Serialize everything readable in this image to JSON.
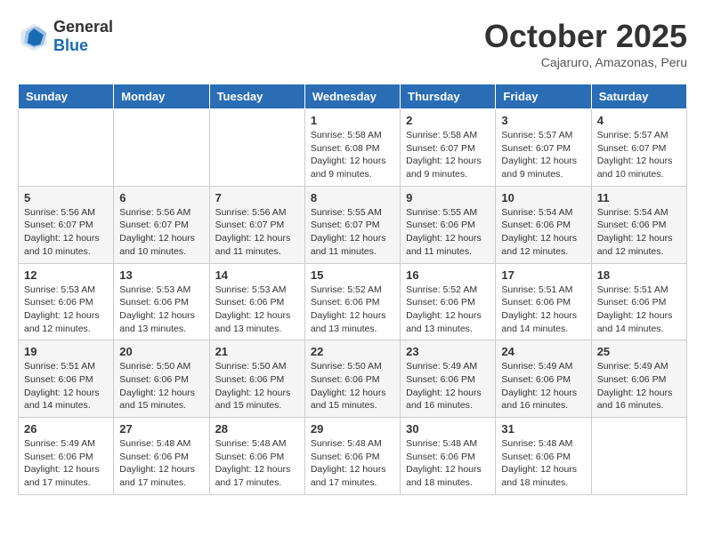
{
  "header": {
    "logo_general": "General",
    "logo_blue": "Blue",
    "month_title": "October 2025",
    "subtitle": "Cajaruro, Amazonas, Peru"
  },
  "calendar": {
    "days_of_week": [
      "Sunday",
      "Monday",
      "Tuesday",
      "Wednesday",
      "Thursday",
      "Friday",
      "Saturday"
    ],
    "weeks": [
      [
        {
          "day": "",
          "info": ""
        },
        {
          "day": "",
          "info": ""
        },
        {
          "day": "",
          "info": ""
        },
        {
          "day": "1",
          "info": "Sunrise: 5:58 AM\nSunset: 6:08 PM\nDaylight: 12 hours and 9 minutes."
        },
        {
          "day": "2",
          "info": "Sunrise: 5:58 AM\nSunset: 6:07 PM\nDaylight: 12 hours and 9 minutes."
        },
        {
          "day": "3",
          "info": "Sunrise: 5:57 AM\nSunset: 6:07 PM\nDaylight: 12 hours and 9 minutes."
        },
        {
          "day": "4",
          "info": "Sunrise: 5:57 AM\nSunset: 6:07 PM\nDaylight: 12 hours and 10 minutes."
        }
      ],
      [
        {
          "day": "5",
          "info": "Sunrise: 5:56 AM\nSunset: 6:07 PM\nDaylight: 12 hours and 10 minutes."
        },
        {
          "day": "6",
          "info": "Sunrise: 5:56 AM\nSunset: 6:07 PM\nDaylight: 12 hours and 10 minutes."
        },
        {
          "day": "7",
          "info": "Sunrise: 5:56 AM\nSunset: 6:07 PM\nDaylight: 12 hours and 11 minutes."
        },
        {
          "day": "8",
          "info": "Sunrise: 5:55 AM\nSunset: 6:07 PM\nDaylight: 12 hours and 11 minutes."
        },
        {
          "day": "9",
          "info": "Sunrise: 5:55 AM\nSunset: 6:06 PM\nDaylight: 12 hours and 11 minutes."
        },
        {
          "day": "10",
          "info": "Sunrise: 5:54 AM\nSunset: 6:06 PM\nDaylight: 12 hours and 12 minutes."
        },
        {
          "day": "11",
          "info": "Sunrise: 5:54 AM\nSunset: 6:06 PM\nDaylight: 12 hours and 12 minutes."
        }
      ],
      [
        {
          "day": "12",
          "info": "Sunrise: 5:53 AM\nSunset: 6:06 PM\nDaylight: 12 hours and 12 minutes."
        },
        {
          "day": "13",
          "info": "Sunrise: 5:53 AM\nSunset: 6:06 PM\nDaylight: 12 hours and 13 minutes."
        },
        {
          "day": "14",
          "info": "Sunrise: 5:53 AM\nSunset: 6:06 PM\nDaylight: 12 hours and 13 minutes."
        },
        {
          "day": "15",
          "info": "Sunrise: 5:52 AM\nSunset: 6:06 PM\nDaylight: 12 hours and 13 minutes."
        },
        {
          "day": "16",
          "info": "Sunrise: 5:52 AM\nSunset: 6:06 PM\nDaylight: 12 hours and 13 minutes."
        },
        {
          "day": "17",
          "info": "Sunrise: 5:51 AM\nSunset: 6:06 PM\nDaylight: 12 hours and 14 minutes."
        },
        {
          "day": "18",
          "info": "Sunrise: 5:51 AM\nSunset: 6:06 PM\nDaylight: 12 hours and 14 minutes."
        }
      ],
      [
        {
          "day": "19",
          "info": "Sunrise: 5:51 AM\nSunset: 6:06 PM\nDaylight: 12 hours and 14 minutes."
        },
        {
          "day": "20",
          "info": "Sunrise: 5:50 AM\nSunset: 6:06 PM\nDaylight: 12 hours and 15 minutes."
        },
        {
          "day": "21",
          "info": "Sunrise: 5:50 AM\nSunset: 6:06 PM\nDaylight: 12 hours and 15 minutes."
        },
        {
          "day": "22",
          "info": "Sunrise: 5:50 AM\nSunset: 6:06 PM\nDaylight: 12 hours and 15 minutes."
        },
        {
          "day": "23",
          "info": "Sunrise: 5:49 AM\nSunset: 6:06 PM\nDaylight: 12 hours and 16 minutes."
        },
        {
          "day": "24",
          "info": "Sunrise: 5:49 AM\nSunset: 6:06 PM\nDaylight: 12 hours and 16 minutes."
        },
        {
          "day": "25",
          "info": "Sunrise: 5:49 AM\nSunset: 6:06 PM\nDaylight: 12 hours and 16 minutes."
        }
      ],
      [
        {
          "day": "26",
          "info": "Sunrise: 5:49 AM\nSunset: 6:06 PM\nDaylight: 12 hours and 17 minutes."
        },
        {
          "day": "27",
          "info": "Sunrise: 5:48 AM\nSunset: 6:06 PM\nDaylight: 12 hours and 17 minutes."
        },
        {
          "day": "28",
          "info": "Sunrise: 5:48 AM\nSunset: 6:06 PM\nDaylight: 12 hours and 17 minutes."
        },
        {
          "day": "29",
          "info": "Sunrise: 5:48 AM\nSunset: 6:06 PM\nDaylight: 12 hours and 17 minutes."
        },
        {
          "day": "30",
          "info": "Sunrise: 5:48 AM\nSunset: 6:06 PM\nDaylight: 12 hours and 18 minutes."
        },
        {
          "day": "31",
          "info": "Sunrise: 5:48 AM\nSunset: 6:06 PM\nDaylight: 12 hours and 18 minutes."
        },
        {
          "day": "",
          "info": ""
        }
      ]
    ]
  }
}
